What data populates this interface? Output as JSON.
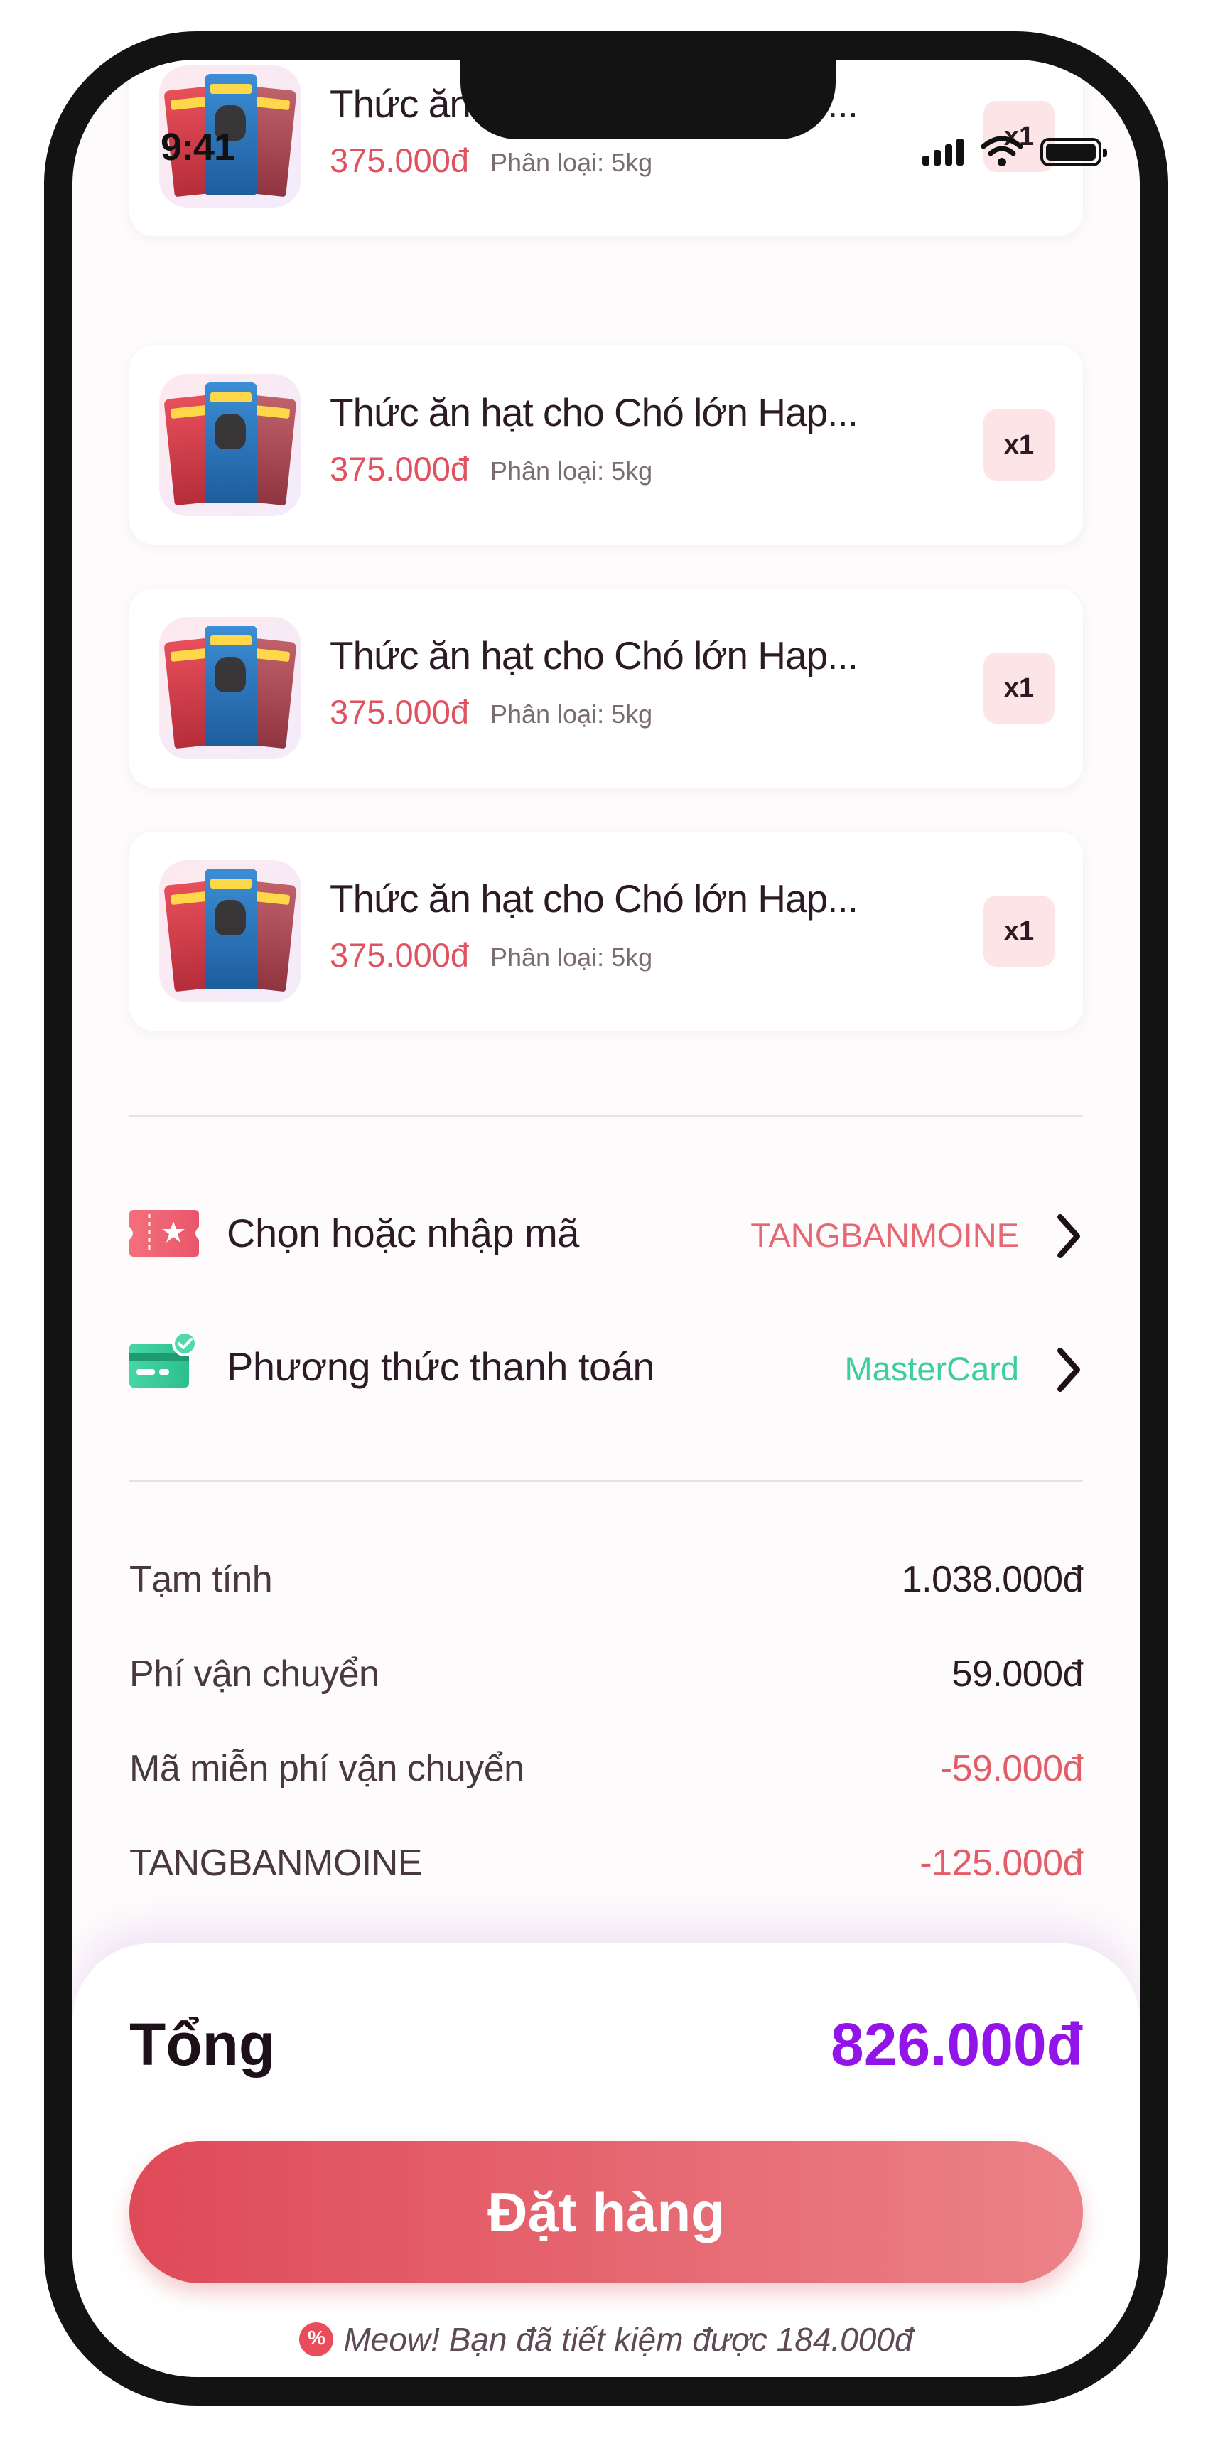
{
  "status_bar": {
    "time": "9:41"
  },
  "cart_items": [
    {
      "name": "Thức ăn hạt cho Chó lớn Hap...",
      "price": "375.000đ",
      "variant": "Phân loại: 5kg",
      "qty": "x1"
    },
    {
      "name": "Thức ăn hạt cho Chó lớn Hap...",
      "price": "375.000đ",
      "variant": "Phân loại: 5kg",
      "qty": "x1"
    },
    {
      "name": "Thức ăn hạt cho Chó lớn Hap...",
      "price": "375.000đ",
      "variant": "Phân loại: 5kg",
      "qty": "x1"
    },
    {
      "name": "Thức ăn hạt cho Chó lớn Hap...",
      "price": "375.000đ",
      "variant": "Phân loại: 5kg",
      "qty": "x1"
    }
  ],
  "options": {
    "voucher": {
      "label": "Chọn hoặc nhập mã",
      "value": "TANGBANMOINE",
      "icon": "ticket-icon",
      "color": "#e66873"
    },
    "payment": {
      "label": "Phương thức thanh toán",
      "value": "MasterCard",
      "icon": "card-icon",
      "color": "#3ccf9c"
    }
  },
  "summary": {
    "subtotal": {
      "label": "Tạm tính",
      "value": "1.038.000đ"
    },
    "shipping": {
      "label": "Phí vận chuyển",
      "value": "59.000đ"
    },
    "free_ship": {
      "label": "Mã miễn phí vận chuyển",
      "value": "-59.000đ"
    },
    "promo": {
      "label": "TANGBANMOINE",
      "value": "-125.000đ"
    }
  },
  "checkout": {
    "total_label": "Tổng",
    "total_value": "826.000đ",
    "order_button": "Đặt hàng",
    "savings_text": "Meow! Bạn đã tiết kiệm được 184.000đ"
  },
  "colors": {
    "price": "#e0525f",
    "total": "#9314e8",
    "button_start": "#df4a58",
    "button_end": "#ec8288"
  }
}
